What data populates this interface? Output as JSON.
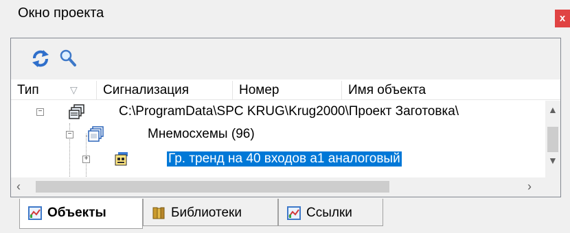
{
  "window": {
    "title": "Окно проекта",
    "close_label": "x"
  },
  "toolbar": {
    "refresh_icon": "refresh-icon",
    "search_icon": "search-icon"
  },
  "columns": {
    "type": "Тип",
    "alarm": "Сигнализация",
    "number": "Номер",
    "object_name": "Имя объекта"
  },
  "tree": {
    "root": "C:\\ProgramData\\SPC KRUG\\Krug2000\\Проект Заготовка\\",
    "group": "Мнемосхемы (96)",
    "selected_item": "Гр. тренд на 40 входов а1 аналоговый"
  },
  "tabs": [
    {
      "label": "Объекты",
      "active": true
    },
    {
      "label": "Библиотеки",
      "active": false
    },
    {
      "label": "Ссылки",
      "active": false
    }
  ],
  "colors": {
    "selection": "#0078d7",
    "close": "#e04343"
  }
}
